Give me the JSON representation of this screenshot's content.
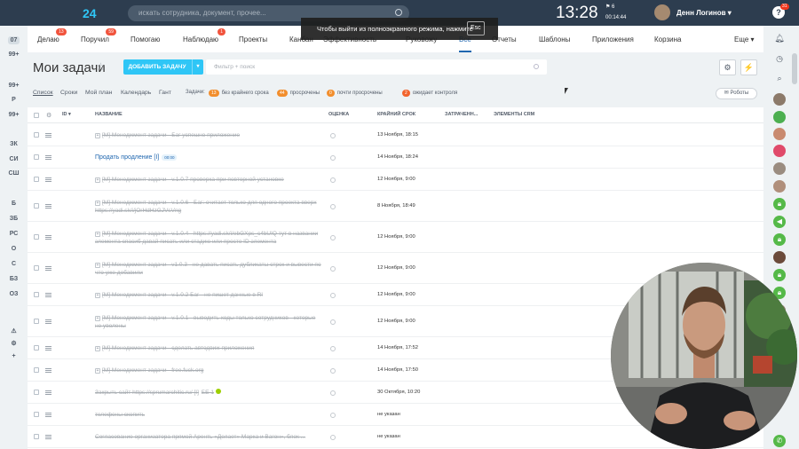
{
  "topbar": {
    "logo": "24",
    "search_placeholder": "искать сотрудника, документ, прочее...",
    "time": "13:28",
    "flag_count": "6",
    "timer": "00:14:44",
    "user_name": "Денн Логинов",
    "help_label": "?",
    "notif_count": "31"
  },
  "fullscreen_tip": {
    "text": "Чтобы выйти из полноэкранного режима, нажмите",
    "key": "Esc"
  },
  "left_rail": [
    {
      "label": "07",
      "active": true
    },
    {
      "label": "99+"
    },
    {
      "label": ""
    },
    {
      "label": "99+"
    },
    {
      "label": "Р"
    },
    {
      "label": "99+"
    },
    {
      "label": "ЗК"
    },
    {
      "label": "СИ"
    },
    {
      "label": "СШ"
    },
    {
      "label": ""
    },
    {
      "label": "Б"
    },
    {
      "label": "ЗБ"
    },
    {
      "label": "РС"
    },
    {
      "label": "О"
    },
    {
      "label": "С"
    },
    {
      "label": "БЗ"
    },
    {
      "label": "ОЗ"
    },
    {
      "label": ""
    },
    {
      "label": "⚠"
    },
    {
      "label": "⚙"
    },
    {
      "label": "+"
    }
  ],
  "tabs": [
    {
      "label": "Делаю",
      "count": "13"
    },
    {
      "label": "Поручил",
      "count": "59"
    },
    {
      "label": "Помогаю",
      "count": ""
    },
    {
      "label": "Наблюдаю",
      "count": "1"
    },
    {
      "label": "Проекты",
      "count": ""
    },
    {
      "label": "Канбан",
      "count": ""
    },
    {
      "label": "Эффективность",
      "count": ""
    },
    {
      "label": "Руковожу",
      "count": ""
    },
    {
      "label": "Все",
      "count": "",
      "active": true
    },
    {
      "label": "Отчеты",
      "count": ""
    },
    {
      "label": "Шаблоны",
      "count": ""
    },
    {
      "label": "Приложения",
      "count": ""
    },
    {
      "label": "Корзина",
      "count": ""
    },
    {
      "label": "Еще ▾",
      "count": ""
    }
  ],
  "page": {
    "title": "Мои задачи",
    "add_button": "ДОБАВИТЬ ЗАДАЧУ",
    "filter_placeholder": "Фильтр + поиск",
    "settings_icon": "gear-icon",
    "lightning_icon": "lightning-icon",
    "robots_button": "Роботы"
  },
  "views": [
    "Список",
    "Сроки",
    "Мой план",
    "Календарь",
    "Гант"
  ],
  "counters": {
    "label": "Задачи:",
    "items": [
      {
        "count": "13",
        "text": "без крайнего срока",
        "color": "#f28e2d"
      },
      {
        "count": "44",
        "text": "просрочены",
        "color": "#f28e2d"
      },
      {
        "count": "0",
        "text": "почти просрочены",
        "color": "#f28e2d"
      },
      {
        "count": "2",
        "text": "ожидает контроля",
        "color": "#f2642d"
      }
    ]
  },
  "columns": [
    "ID ▾",
    "НАЗВАНИЕ",
    "ОЦЕНКА",
    "КРАЙНИЙ СРОК",
    "ЗАТРАЧЕНН...",
    "ЭЛЕМЕНТЫ CRM"
  ],
  "rows": [
    {
      "title": "[M] Менеджмент задачи - Баг успешно приложение",
      "deadline": "13 Ноября, 18:15",
      "done": true,
      "plus": true
    },
    {
      "title": "Продать продление [I]",
      "deadline": "14 Ноября, 18:24",
      "done": false,
      "chip": "00:00"
    },
    {
      "title": "[M] Менеджмент задачи - v.1.0.7 проверка при повторной установке",
      "deadline": "12 Ноября, 9:00",
      "done": true,
      "plus": true
    },
    {
      "title": "[M] Менеджмент задачи - v.1.0.6 - Баг: считает только для одного проекта вверх https://yadi.sk/i/jOrHdHzGJVsVng",
      "deadline": "8 Ноября, 18:49",
      "done": true,
      "plus": true
    },
    {
      "title": "[M] Менеджмент задачи - v.1.0.4 - https://yadi.sk/i/ebGXps_c4bUIQ тут в названии элемента спасиб давай писать или стадию или просто ID элемента",
      "deadline": "12 Ноября, 9:00",
      "done": true,
      "plus": true
    },
    {
      "title": "[M] Менеджмент задачи - v1.0.3 - не давать писать дубликаты строк и вывести по что уже добавили",
      "deadline": "12 Ноября, 9:00",
      "done": true,
      "plus": true
    },
    {
      "title": "[M] Менеджмент задачи - v.1.0.2 Баг - не пишет данные в RI",
      "deadline": "12 Ноября, 9:00",
      "done": true,
      "plus": true
    },
    {
      "title": "[M] Менеджмент задачи - v.1.0.1 - выводить ходы только сотрудников - которые не уволены",
      "deadline": "12 Ноября, 9:00",
      "done": true,
      "plus": true
    },
    {
      "title": "[M] Менеджмент задачи - сделать автодвиж приложения",
      "deadline": "14 Ноября, 17:52",
      "done": true,
      "plus": true
    },
    {
      "title": "[M] Менеджмент задачи - free.fuck.org",
      "deadline": "14 Ноября, 17:50",
      "done": true,
      "plus": true
    },
    {
      "title": "Закрыть сайт https://sprumarchitic.ru/ [I]",
      "deadline": "30 Октября, 10:20",
      "done": true,
      "extra": "БЕ 1",
      "greendot": true
    },
    {
      "title": "телефоны скопить",
      "deadline": "не указан",
      "done": true
    },
    {
      "title": "Согласование организатора прямой Аренть «Делает» Марка и Вагон», блок ...",
      "deadline": "не указан",
      "done": true
    }
  ],
  "right_rail": [
    "bell-icon",
    "clock-icon",
    "search-icon",
    "avatar",
    "avatar",
    "avatar",
    "avatar",
    "avatar",
    "avatar",
    "lock-icon",
    "megaphone-icon",
    "lock-icon",
    "avatar",
    "lock-icon",
    "lock-icon",
    "avatar",
    "phone-icon"
  ],
  "colors": {
    "topbar": "#2d3d4f",
    "accent": "#2fc6f6",
    "link": "#2067b0",
    "badge": "#f1543d"
  }
}
